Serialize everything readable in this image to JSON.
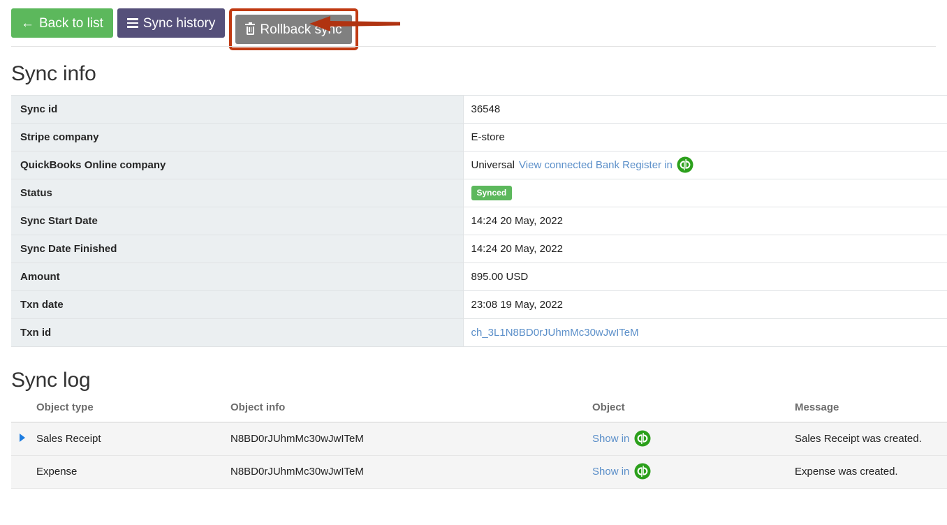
{
  "toolbar": {
    "back_label": "Back to list",
    "back_icon": "arrow-left-icon",
    "back_color": "#5cb85c",
    "history_label": "Sync history",
    "history_icon": "list-icon",
    "history_color": "#55507a",
    "rollback_label": "Rollback sync",
    "rollback_icon": "trash-icon",
    "rollback_color": "#808080",
    "highlight_color": "#c03a12",
    "annotation_arrow": "left-arrow-annotation"
  },
  "sync_info": {
    "title": "Sync info",
    "rows": [
      {
        "label": "Sync id",
        "value": "36548",
        "type": "text"
      },
      {
        "label": "Stripe company",
        "value": "E-store",
        "type": "text"
      },
      {
        "label": "QuickBooks Online company",
        "value": "Universal",
        "link_text": "View connected Bank Register in",
        "icon": "quickbooks-logo",
        "type": "link-with-icon"
      },
      {
        "label": "Status",
        "value": "Synced",
        "type": "badge",
        "badge_color": "#5cb85c"
      },
      {
        "label": "Sync Start Date",
        "value": "14:24 20 May, 2022",
        "type": "text"
      },
      {
        "label": "Sync Date Finished",
        "value": "14:24 20 May, 2022",
        "type": "text"
      },
      {
        "label": "Amount",
        "value": "895.00 USD",
        "type": "text"
      },
      {
        "label": "Txn date",
        "value": "23:08 19 May, 2022",
        "type": "text"
      },
      {
        "label": "Txn id",
        "value": "ch_3L1N8BD0rJUhmMc30wJwITeM",
        "type": "link"
      }
    ]
  },
  "sync_log": {
    "title": "Sync log",
    "headers": {
      "object_type": "Object type",
      "object_info": "Object info",
      "object": "Object",
      "message": "Message"
    },
    "rows": [
      {
        "expandable": true,
        "object_type": "Sales Receipt",
        "object_info": "N8BD0rJUhmMc30wJwITeM",
        "object_link": "Show in",
        "object_icon": "quickbooks-logo",
        "message": "Sales Receipt was created."
      },
      {
        "expandable": false,
        "object_type": "Expense",
        "object_info": "N8BD0rJUhmMc30wJwITeM",
        "object_link": "Show in",
        "object_icon": "quickbooks-logo",
        "message": "Expense was created."
      }
    ]
  },
  "colors": {
    "link": "#5b8fc9",
    "quickbooks_green": "#2ca01c",
    "label_bg": "#ebeff1",
    "row_bg": "#f5f5f5"
  }
}
